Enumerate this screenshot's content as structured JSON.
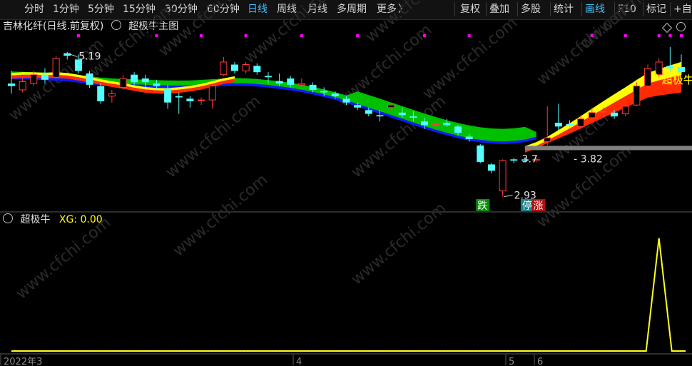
{
  "toolbar": {
    "periods": [
      "分时",
      "1分钟",
      "5分钟",
      "15分钟",
      "30分钟",
      "60分钟",
      "日线",
      "周线",
      "月线",
      "多周期",
      "更多"
    ],
    "active_period": "日线",
    "more_arrow": "〉",
    "tools": [
      "复权",
      "叠加",
      "多股",
      "统计",
      "画线",
      "F10",
      "标记",
      "+自"
    ],
    "active_tool": "画线"
  },
  "main_header": {
    "stock_name": "吉林化纤(日线.前复权)",
    "indicator_name": "超极牛主图",
    "diamond_icon": "diamond-icon",
    "circle_icon": "circle-icon"
  },
  "sub_header": {
    "indicator_name": "超极牛",
    "xg_label": "XG: 0.00"
  },
  "colors": {
    "up": "#ff3c3c",
    "down": "#54ffff",
    "yellow": "#ffff00",
    "red_band": "#ff2a00",
    "green_band": "#00c000",
    "blue_band": "#0a1cff",
    "magenta": "#ff00ff",
    "gray_line": "#808080"
  },
  "chart_data": [
    {
      "type": "candlestick",
      "title": "吉林化纤(日线.前复权)",
      "indicator": "超极牛主图",
      "x_axis_labels": [
        "2022年3",
        "4",
        "5",
        "6"
      ],
      "ylim": [
        2.7,
        5.5
      ],
      "candles": [
        {
          "o": 4.72,
          "c": 4.68,
          "h": 4.92,
          "l": 4.56
        },
        {
          "o": 4.62,
          "c": 4.75,
          "h": 4.82,
          "l": 4.58
        },
        {
          "o": 4.72,
          "c": 4.86,
          "h": 4.92,
          "l": 4.68
        },
        {
          "o": 4.86,
          "c": 4.78,
          "h": 4.96,
          "l": 4.72
        },
        {
          "o": 4.82,
          "c": 5.12,
          "h": 5.16,
          "l": 4.8
        },
        {
          "o": 5.2,
          "c": 5.16,
          "h": 5.22,
          "l": 5.1
        },
        {
          "o": 5.1,
          "c": 4.92,
          "h": 5.18,
          "l": 4.88
        },
        {
          "o": 4.88,
          "c": 4.7,
          "h": 4.92,
          "l": 4.65
        },
        {
          "o": 4.68,
          "c": 4.44,
          "h": 4.72,
          "l": 4.4
        },
        {
          "o": 4.52,
          "c": 4.56,
          "h": 4.62,
          "l": 4.42
        },
        {
          "o": 4.66,
          "c": 4.8,
          "h": 4.86,
          "l": 4.62
        },
        {
          "o": 4.86,
          "c": 4.74,
          "h": 4.9,
          "l": 4.7
        },
        {
          "o": 4.8,
          "c": 4.74,
          "h": 4.86,
          "l": 4.66
        },
        {
          "o": 4.72,
          "c": 4.68,
          "h": 4.78,
          "l": 4.62
        },
        {
          "o": 4.64,
          "c": 4.42,
          "h": 4.7,
          "l": 4.32
        },
        {
          "o": 4.52,
          "c": 4.5,
          "h": 4.58,
          "l": 4.24
        },
        {
          "o": 4.48,
          "c": 4.44,
          "h": 4.52,
          "l": 4.34
        },
        {
          "o": 4.46,
          "c": 4.46,
          "h": 4.5,
          "l": 4.38
        },
        {
          "o": 4.46,
          "c": 4.68,
          "h": 4.72,
          "l": 4.32
        },
        {
          "o": 4.86,
          "c": 5.06,
          "h": 5.14,
          "l": 4.84
        },
        {
          "o": 5.02,
          "c": 4.92,
          "h": 5.06,
          "l": 4.88
        },
        {
          "o": 4.92,
          "c": 5.02,
          "h": 5.06,
          "l": 4.88
        },
        {
          "o": 5.0,
          "c": 4.9,
          "h": 5.04,
          "l": 4.86
        },
        {
          "o": 4.84,
          "c": 4.82,
          "h": 4.9,
          "l": 4.72
        },
        {
          "o": 4.76,
          "c": 4.72,
          "h": 4.88,
          "l": 4.68
        },
        {
          "o": 4.8,
          "c": 4.7,
          "h": 4.84,
          "l": 4.66
        },
        {
          "o": 4.7,
          "c": 4.72,
          "h": 4.8,
          "l": 4.66
        },
        {
          "o": 4.7,
          "c": 4.62,
          "h": 4.74,
          "l": 4.58
        },
        {
          "o": 4.6,
          "c": 4.58,
          "h": 4.66,
          "l": 4.52
        },
        {
          "o": 4.56,
          "c": 4.52,
          "h": 4.6,
          "l": 4.48
        },
        {
          "o": 4.48,
          "c": 4.42,
          "h": 4.52,
          "l": 4.38
        },
        {
          "o": 4.38,
          "c": 4.34,
          "h": 4.42,
          "l": 4.3
        },
        {
          "o": 4.3,
          "c": 4.24,
          "h": 4.34,
          "l": 4.2
        },
        {
          "o": 4.22,
          "c": 4.2,
          "h": 4.3,
          "l": 4.12
        },
        {
          "o": 4.34,
          "c": 4.38,
          "h": 4.42,
          "l": 4.28
        },
        {
          "o": 4.26,
          "c": 4.22,
          "h": 4.34,
          "l": 4.18
        },
        {
          "o": 4.2,
          "c": 4.18,
          "h": 4.28,
          "l": 4.12
        },
        {
          "o": 4.12,
          "c": 4.06,
          "h": 4.18,
          "l": 4.0
        },
        {
          "o": 4.08,
          "c": 4.08,
          "h": 4.14,
          "l": 4.0
        },
        {
          "o": 4.1,
          "c": 4.06,
          "h": 4.16,
          "l": 4.04
        },
        {
          "o": 4.04,
          "c": 3.94,
          "h": 4.06,
          "l": 3.9
        },
        {
          "o": 3.88,
          "c": 3.84,
          "h": 3.92,
          "l": 3.8
        },
        {
          "o": 3.74,
          "c": 3.48,
          "h": 3.76,
          "l": 3.46
        },
        {
          "o": 3.44,
          "c": 3.34,
          "h": 3.46,
          "l": 3.3
        },
        {
          "o": 3.02,
          "c": 3.5,
          "h": 3.52,
          "l": 2.93
        },
        {
          "o": 3.52,
          "c": 3.5,
          "h": 3.54,
          "l": 3.46
        },
        {
          "o": 3.52,
          "c": 3.5,
          "h": 3.54,
          "l": 3.48
        },
        {
          "o": 3.5,
          "c": 3.52,
          "h": 3.54,
          "l": 3.48
        },
        {
          "o": 3.8,
          "c": 3.86,
          "h": 4.36,
          "l": 3.74
        },
        {
          "o": 4.1,
          "c": 4.04,
          "h": 4.4,
          "l": 3.98
        },
        {
          "o": 4.08,
          "c": 4.06,
          "h": 4.14,
          "l": 4.02
        },
        {
          "o": 4.04,
          "c": 4.16,
          "h": 4.22,
          "l": 4.0
        },
        {
          "o": 4.18,
          "c": 4.26,
          "h": 4.34,
          "l": 4.14
        },
        {
          "o": 4.28,
          "c": 4.28,
          "h": 4.34,
          "l": 4.2
        },
        {
          "o": 4.26,
          "c": 4.2,
          "h": 4.3,
          "l": 4.16
        },
        {
          "o": 4.24,
          "c": 4.36,
          "h": 4.4,
          "l": 4.2
        },
        {
          "o": 4.38,
          "c": 4.68,
          "h": 4.74,
          "l": 4.36
        },
        {
          "o": 4.68,
          "c": 4.96,
          "h": 5.02,
          "l": 4.64
        },
        {
          "o": 4.86,
          "c": 5.06,
          "h": 5.12,
          "l": 4.8
        },
        {
          "o": 5.0,
          "c": 4.96,
          "h": 5.3,
          "l": 4.9
        },
        {
          "o": 4.98,
          "c": 4.9,
          "h": 5.18,
          "l": 4.86
        }
      ],
      "markers": [
        {
          "text": "5.19",
          "kind": "high",
          "at": 5,
          "value": 5.19
        },
        {
          "text": "2.93",
          "kind": "low",
          "at": 44,
          "value": 2.93
        },
        {
          "text": "3.7",
          "kind": "range-start",
          "at": 47
        },
        {
          "text": "- 3.82",
          "kind": "range-end",
          "at": 51
        },
        {
          "text": "超极牛",
          "kind": "signal",
          "at": 58
        }
      ],
      "signal_tags": [
        {
          "text": "跌",
          "at": 42,
          "color": "green"
        },
        {
          "text": "停财",
          "at": 46,
          "color": "cyan"
        },
        {
          "text": "涨",
          "at": 47,
          "color": "red"
        }
      ],
      "magenta_dots_at": [
        6,
        13,
        17,
        21,
        26,
        31,
        37,
        41,
        52,
        55,
        58,
        59,
        60
      ],
      "reference_line": {
        "value": 3.7,
        "label": "3.7 - 3.82"
      }
    },
    {
      "type": "line",
      "title": "超极牛",
      "series": [
        {
          "name": "XG",
          "current": 0.0
        }
      ],
      "ylim": [
        0,
        1.1
      ],
      "values_spike_at": 58,
      "spike_value": 1.0
    }
  ]
}
